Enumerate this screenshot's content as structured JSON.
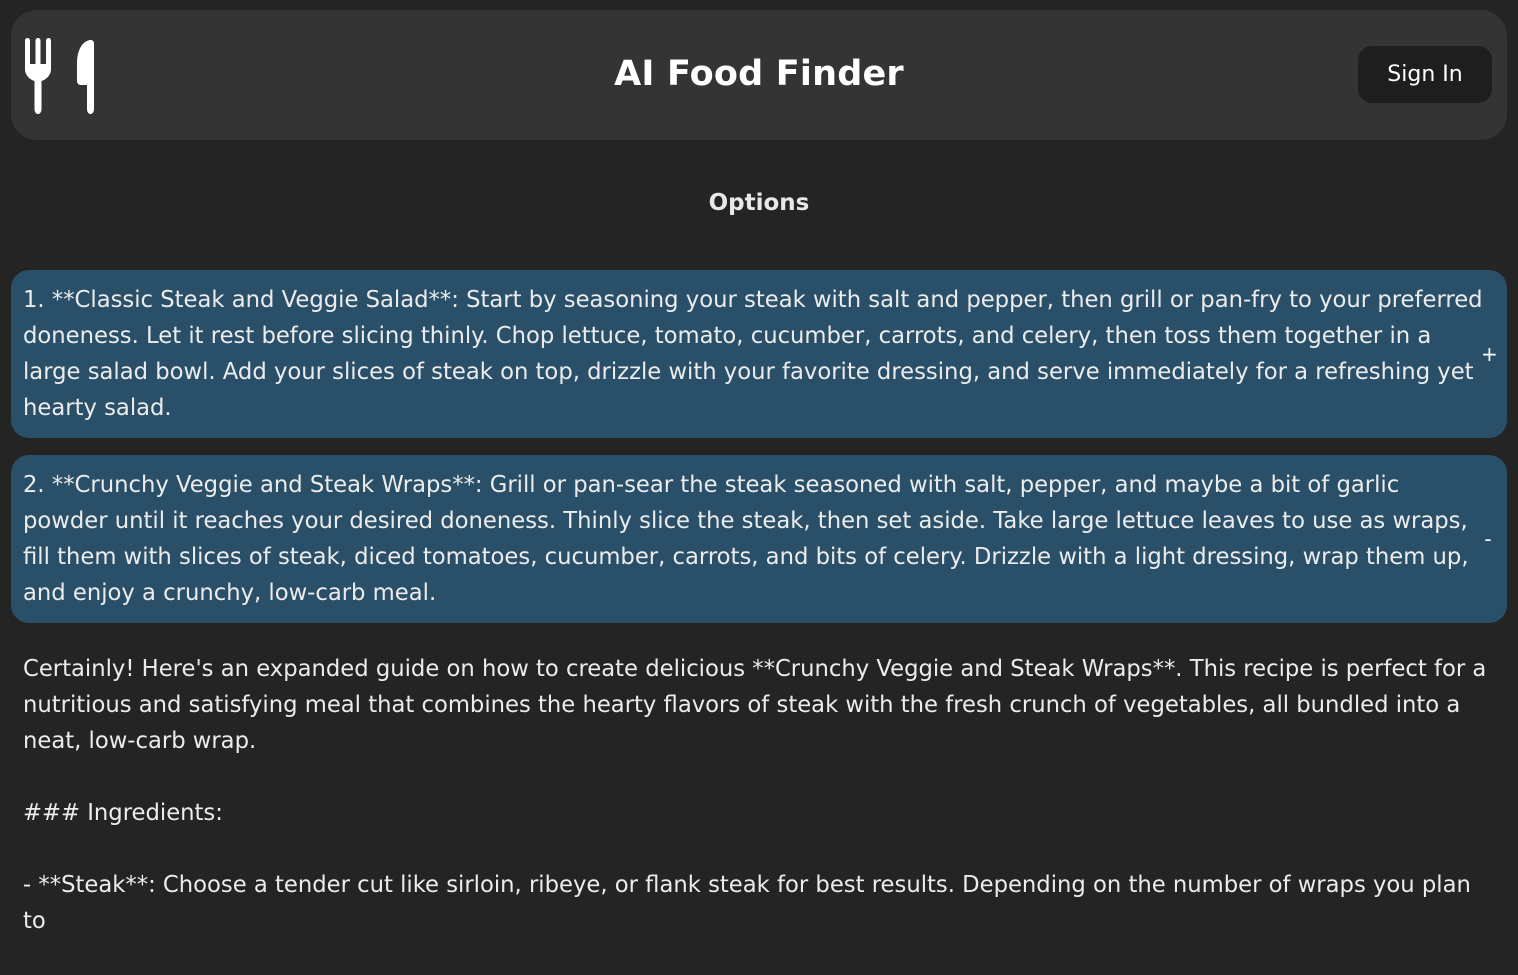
{
  "header": {
    "logo_icon": "fork-knife-icon",
    "title": "AI Food Finder",
    "sign_in_label": "Sign In"
  },
  "options": {
    "heading": "Options",
    "items": [
      {
        "text": "1. **Classic Steak and Veggie Salad**: Start by seasoning your steak with salt and pepper, then grill or pan-fry to your preferred doneness. Let it rest before slicing thinly. Chop lettuce, tomato, cucumber, carrots, and celery, then toss them together in a large salad bowl. Add your slices of steak on top, drizzle with your favorite dressing, and serve immediately for a refreshing yet hearty salad.",
        "toggle": "+"
      },
      {
        "text": "2. **Crunchy Veggie and Steak Wraps**: Grill or pan-sear the steak seasoned with salt, pepper, and maybe a bit of garlic powder until it reaches your desired doneness. Thinly slice the steak, then set aside. Take large lettuce leaves to use as wraps, fill them with slices of steak, diced tomatoes, cucumber, carrots, and bits of celery. Drizzle with a light dressing, wrap them up, and enjoy a crunchy, low-carb meal.",
        "toggle": "-"
      }
    ]
  },
  "response": {
    "intro": "Certainly! Here's an expanded guide on how to create delicious **Crunchy Veggie and Steak Wraps**. This recipe is perfect for a nutritious and satisfying meal that combines the hearty flavors of steak with the fresh crunch of vegetables, all bundled into a neat, low-carb wrap.",
    "ingredients_heading": "### Ingredients:",
    "ingredient_steak": "- **Steak**: Choose a tender cut like sirloin, ribeye, or flank steak for best results. Depending on the number of wraps you plan to"
  },
  "colors": {
    "background": "#242424",
    "header_bg": "#343434",
    "card_bg": "#2a5069",
    "button_bg": "#1e1e1e"
  }
}
